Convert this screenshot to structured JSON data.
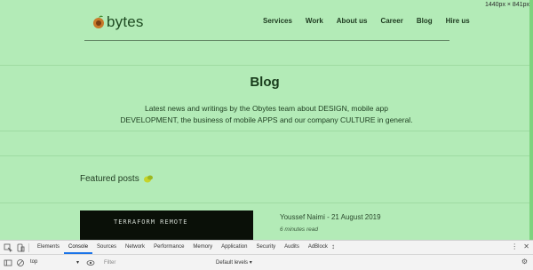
{
  "viewport": {
    "dimensions_label": "1440px × 841px"
  },
  "site": {
    "logo_text": "bytes",
    "nav": [
      "Services",
      "Work",
      "About us",
      "Career",
      "Blog",
      "Hire us"
    ],
    "title": "Blog",
    "subtitle": "Latest news and writings by the Obytes team about DESIGN, mobile app DEVELOPMENT, the business of mobile APPS and our company CULTURE in general.",
    "featured_label": "Featured posts",
    "post": {
      "image_text": "TERRAFORM REMOTE",
      "meta": "Youssef Naimi - 21 August 2019",
      "read_time": "6 minutes read"
    }
  },
  "devtools": {
    "tabs": [
      "Elements",
      "Console",
      "Sources",
      "Network",
      "Performance",
      "Memory",
      "Application",
      "Security",
      "Audits",
      "AdBlock"
    ],
    "active_tab": "Console",
    "context": "top",
    "filter_placeholder": "Filter",
    "levels": "Default levels"
  }
}
